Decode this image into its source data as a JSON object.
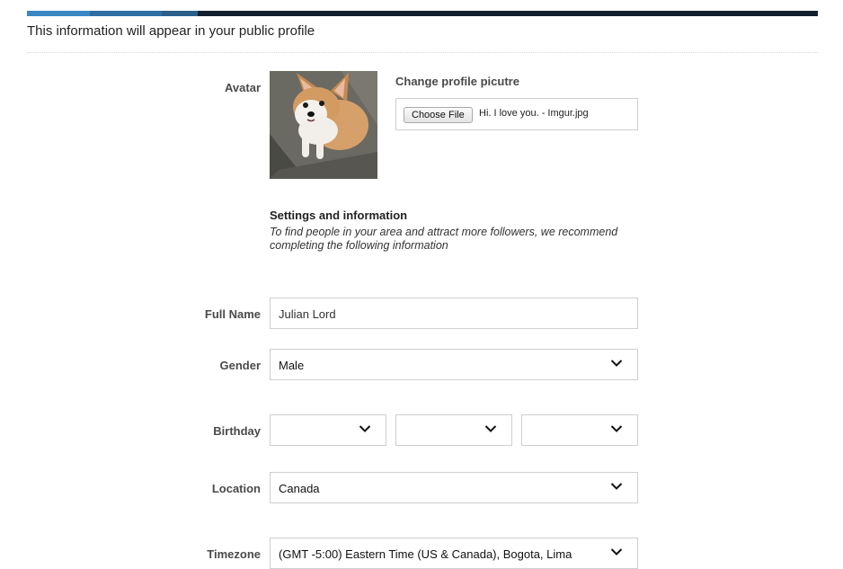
{
  "intro": "This information will appear in your public profile",
  "avatar": {
    "label": "Avatar",
    "change_title": "Change profile picutre",
    "file_button": "Choose File",
    "file_name": "Hi. I love you. - Imgur.jpg"
  },
  "settings": {
    "title": "Settings and information",
    "description": "To find people in your area and attract more followers, we recommend completing the following information"
  },
  "full_name": {
    "label": "Full Name",
    "value": "Julian Lord"
  },
  "gender": {
    "label": "Gender",
    "selected": "Male"
  },
  "birthday": {
    "label": "Birthday",
    "month": "",
    "day": "",
    "year": ""
  },
  "location": {
    "label": "Location",
    "selected": "Canada"
  },
  "timezone": {
    "label": "Timezone",
    "selected": "(GMT -5:00) Eastern Time (US & Canada), Bogota, Lima"
  },
  "icons": {
    "dropdown": "chevron-down-icon",
    "avatar": "corgi-photo"
  },
  "colors": {
    "progress_1": "#3a87c4",
    "progress_2": "#2d6fa3",
    "progress_3": "#2a5f8a",
    "progress_track": "#12202e"
  }
}
